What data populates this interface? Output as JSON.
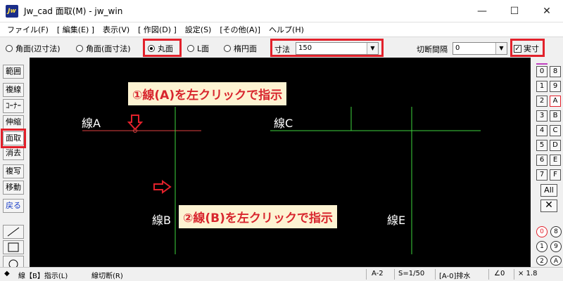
{
  "window": {
    "app_icon_text": "Jw",
    "title": "Jw_cad 面取(M) - jw_win",
    "minimize_glyph": "—",
    "maximize_glyph": "☐",
    "close_glyph": "✕"
  },
  "menu": [
    "ファイル(F)",
    "[ 編集(E) ]",
    "表示(V)",
    "[ 作図(D) ]",
    "設定(S)",
    "[その他(A)]",
    "ヘルプ(H)"
  ],
  "toolbar": {
    "radios": [
      {
        "label": "角面(辺寸法)",
        "checked": false
      },
      {
        "label": "角面(面寸法)",
        "checked": false
      },
      {
        "label": "丸面",
        "checked": true
      },
      {
        "label": "L面",
        "checked": false
      },
      {
        "label": "楕円面",
        "checked": false
      }
    ],
    "dimension_label": "寸法",
    "dimension_value": "150",
    "cut_interval_label": "切断間隔",
    "cut_interval_value": "0",
    "actual_size_label": "実寸",
    "actual_size_checked": true
  },
  "left_tools": [
    {
      "label": "範囲",
      "selected": false
    },
    {
      "label": "複線",
      "selected": false
    },
    {
      "label": "ｺｰﾅｰ",
      "selected": false
    },
    {
      "label": "伸縮",
      "selected": false
    },
    {
      "label": "面取",
      "selected": true
    },
    {
      "label": "消去",
      "selected": false
    },
    {
      "label": "複写",
      "selected": false
    },
    {
      "label": "移動",
      "selected": false
    },
    {
      "label": "戻る",
      "selected": false,
      "accent": true
    }
  ],
  "canvas": {
    "line_labels": [
      "線A",
      "線B",
      "線C",
      "線E"
    ],
    "callouts": [
      "①線(A)を左クリックで指示",
      "②線(B)を左クリックで指示"
    ],
    "colors": {
      "background": "#000000",
      "red_line": "#e04040",
      "green_line": "#3ed43e",
      "callout_text": "#d8262e",
      "callout_bg": "#fdf3d2",
      "highlight": "#e2212b"
    }
  },
  "layers": {
    "left": [
      "0",
      "1",
      "2",
      "3",
      "4",
      "5",
      "6",
      "7"
    ],
    "right": [
      "8",
      "9",
      "A",
      "B",
      "C",
      "D",
      "E",
      "F"
    ],
    "selected_right": "A",
    "all_label": "All",
    "groups": [
      "0",
      "8",
      "1",
      "9",
      "2",
      "A"
    ],
    "selected_group": "0"
  },
  "status": {
    "mark": "◆",
    "instruction": "線【B】指示(L)",
    "hint": "線切断(R)",
    "layer": "A-2",
    "scale": "S=1/50",
    "linetype": "[A-0]排水",
    "angle": "∠0",
    "zoom": "× 1.8"
  }
}
